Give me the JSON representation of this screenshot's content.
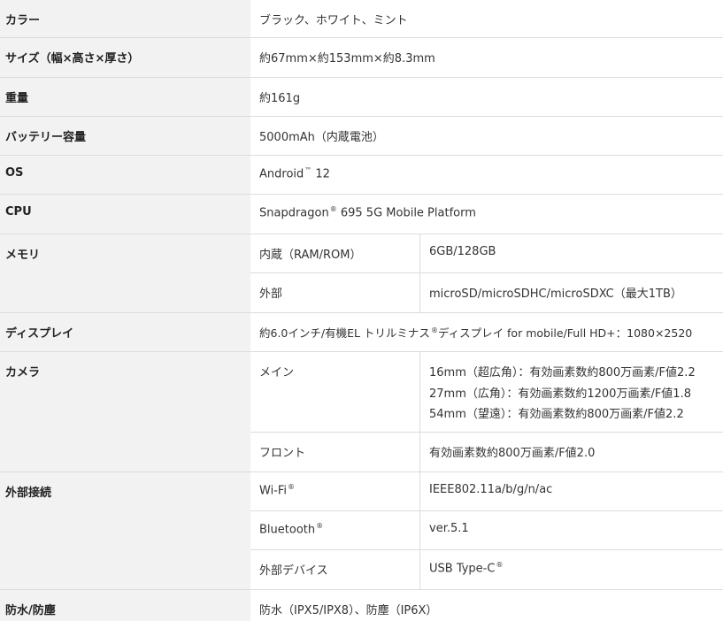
{
  "rows": {
    "color": {
      "label": "カラー",
      "value": "ブラック、ホワイト、ミント"
    },
    "size": {
      "label": "サイズ（幅×高さ×厚さ）",
      "value": "約67mm×約153mm×約8.3mm"
    },
    "weight": {
      "label": "重量",
      "value": "約161g"
    },
    "battery": {
      "label": "バッテリー容量",
      "value": "5000mAh（内蔵電池）"
    },
    "os": {
      "label": "OS",
      "value": "Android",
      "mark": "™",
      "value_after": "12"
    },
    "cpu": {
      "label": "CPU",
      "value": "Snapdragon",
      "mark": "®",
      "value_after": "695 5G Mobile Platform"
    },
    "memory": {
      "label": "メモリ",
      "items": [
        {
          "label": "内蔵（RAM/ROM）",
          "value": "6GB/128GB"
        },
        {
          "label": "外部",
          "value": "microSD/microSDHC/microSDXC（最大1TB）"
        }
      ]
    },
    "display": {
      "label": "ディスプレイ",
      "value": "約6.0インチ/有機EL トリルミナス",
      "mark": "®",
      "value_after": "ディスプレイ for mobile/Full HD+：1080×2520"
    },
    "camera": {
      "label": "カメラ",
      "main_label": "メイン",
      "main_lines": [
        "16mm（超広角）：有効画素数約800万画素/F値2.2",
        "27mm（広角）：有効画素数約1200万画素/F値1.8",
        "54mm（望遠）：有効画素数約800万画素/F値2.2"
      ],
      "front_label": "フロント",
      "front_value": "有効画素数約800万画素/F値2.0"
    },
    "connectivity": {
      "label": "外部接続",
      "wifi_label": "Wi-Fi",
      "wifi_mark": "®",
      "wifi_value": "IEEE802.11a/b/g/n/ac",
      "bt_label": "Bluetooth",
      "bt_mark": "®",
      "bt_value": "ver.5.1",
      "device_label": "外部デバイス",
      "device_value": "USB Type-C",
      "device_mark": "®"
    },
    "waterproof": {
      "label": "防水/防塵",
      "value": "防水（IPX5/IPX8）、防塵（IP6X）"
    }
  }
}
